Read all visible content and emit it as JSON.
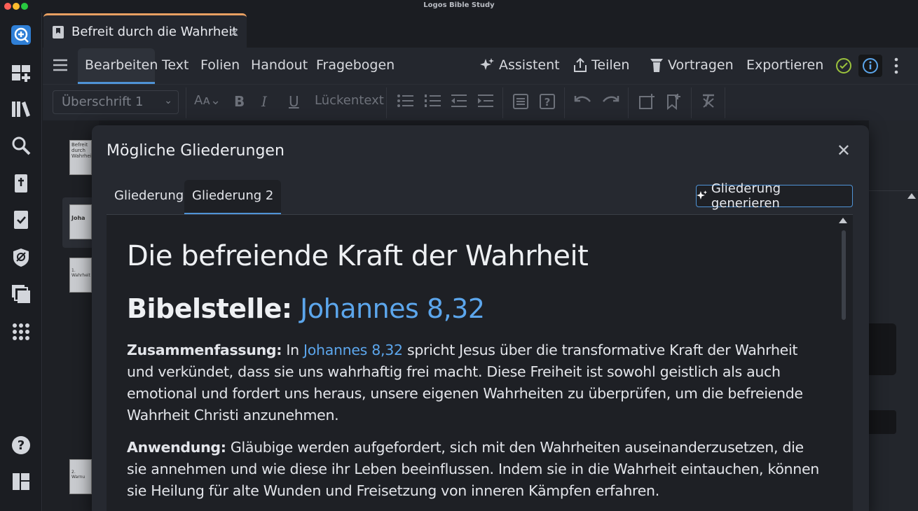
{
  "app_title": "Logos Bible Study",
  "doc_tab": {
    "title": "Befreit durch die Wahrheit",
    "close": "×"
  },
  "menu": {
    "items": [
      "Bearbeiten",
      "Text",
      "Folien",
      "Handout",
      "Fragebogen"
    ],
    "right": [
      "Assistent",
      "Teilen",
      "Vortragen",
      "Exportieren"
    ]
  },
  "toolbar": {
    "style": "Überschrift 1",
    "bold": "B",
    "italic": "I",
    "underline": "U",
    "cloze": "Lückentext"
  },
  "thumbs": [
    "Befreit durch Wahrheit",
    "Joha",
    "1. Wahrheit",
    "2. Warnu"
  ],
  "dialog": {
    "title": "Mögliche Gliederungen",
    "close": "✕",
    "tabs": [
      "Gliederung",
      "Gliederung 2"
    ],
    "generate_button": "Gliederung generieren",
    "heading": "Die befreiende Kraft der Wahrheit",
    "ref_label": "Bibelstelle:",
    "ref_link": "Johannes 8,32",
    "summary_label": "Zusammenfassung:",
    "summary_pre": "In",
    "summary_link": "Johannes 8,32",
    "summary_text": "spricht Jesus über die transformative Kraft der Wahrheit und verkündet, dass sie uns wahrhaftig frei macht. Diese Freiheit ist sowohl geistlich als auch emotional und fordert uns heraus, unsere eigenen Wahrheiten zu überprüfen, um die befreiende Wahrheit Christi anzunehmen.",
    "application_label": "Anwendung:",
    "application_text": "Gläubige werden aufgefordert, sich mit den Wahrheiten auseinanderzusetzen, die sie annehmen und wie diese ihr Leben beeinflussen. Indem sie in die Wahrheit eintauchen, können sie Heilung für alte Wunden und Freisetzung von inneren Kämpfen erfahren."
  },
  "colors": {
    "accent": "#4f93d6",
    "link": "#5ca6ec",
    "tab_accent": "#e8a062",
    "check": "#9bc23c"
  }
}
